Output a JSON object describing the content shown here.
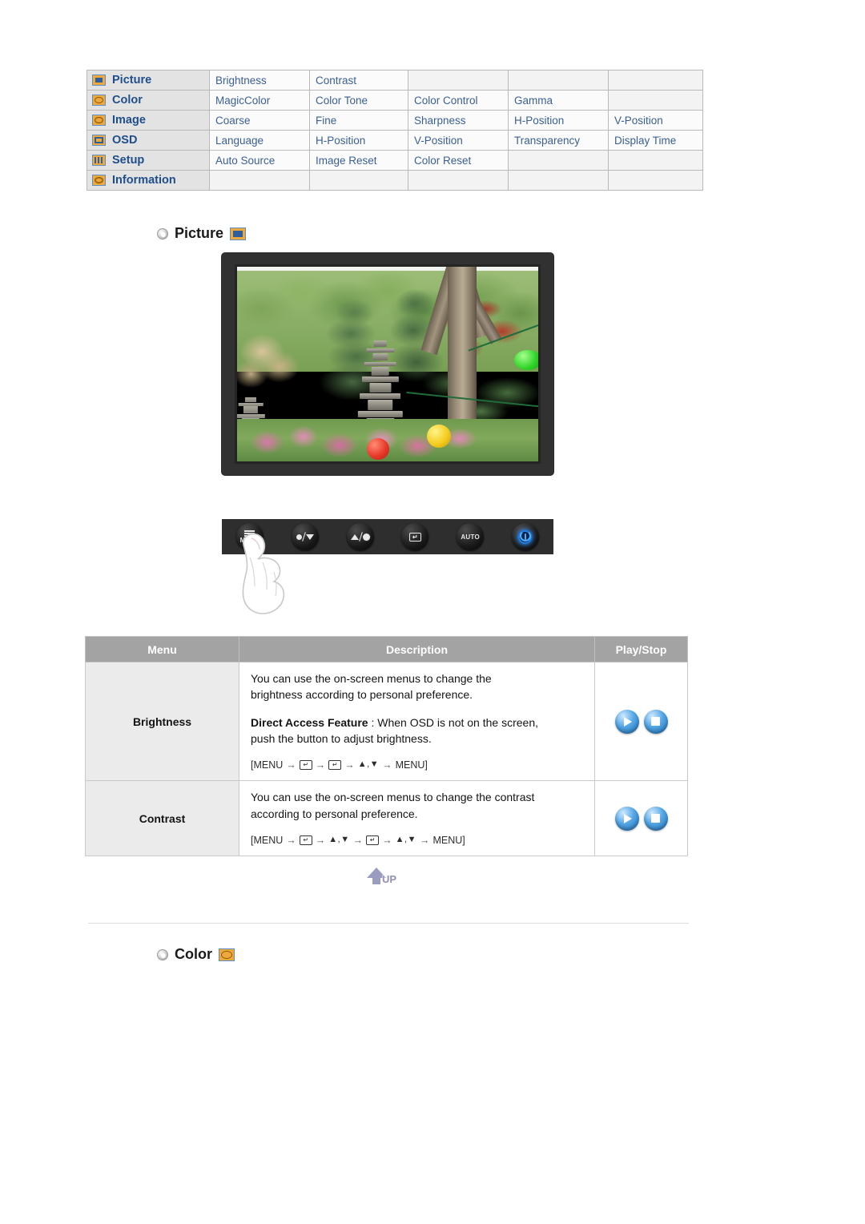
{
  "menu_map": {
    "rows": [
      {
        "icon": "picture-icon",
        "category": "Picture",
        "items": [
          "Brightness",
          "Contrast",
          "",
          "",
          ""
        ]
      },
      {
        "icon": "color-icon",
        "category": "Color",
        "items": [
          "MagicColor",
          "Color Tone",
          "Color Control",
          "Gamma",
          ""
        ]
      },
      {
        "icon": "image-icon",
        "category": "Image",
        "items": [
          "Coarse",
          "Fine",
          "Sharpness",
          "H-Position",
          "V-Position"
        ]
      },
      {
        "icon": "osd-icon",
        "category": "OSD",
        "items": [
          "Language",
          "H-Position",
          "V-Position",
          "Transparency",
          "Display Time"
        ]
      },
      {
        "icon": "setup-icon",
        "category": "Setup",
        "items": [
          "Auto Source",
          "Image Reset",
          "Color Reset",
          "",
          ""
        ]
      },
      {
        "icon": "information-icon",
        "category": "Information",
        "items": [
          "",
          "",
          "",
          "",
          ""
        ]
      }
    ]
  },
  "sections": {
    "picture": {
      "title": "Picture",
      "icon": "picture-icon"
    },
    "color": {
      "title": "Color",
      "icon": "color-icon"
    }
  },
  "monitor": {
    "alt": "Korean garden with stone pagodas, trees and paper lanterns shown on monitor screen"
  },
  "button_bar": {
    "buttons": [
      {
        "name": "menu-button",
        "label": "MENU"
      },
      {
        "name": "down-button",
        "label": ""
      },
      {
        "name": "brightness-up-button",
        "label": ""
      },
      {
        "name": "enter-button",
        "label": ""
      },
      {
        "name": "auto-button",
        "label": "AUTO"
      },
      {
        "name": "power-button",
        "label": ""
      }
    ]
  },
  "desc_table": {
    "headers": [
      "Menu",
      "Description",
      "Play/Stop"
    ],
    "rows": [
      {
        "menu": "Brightness",
        "line1": "You can use the on-screen menus to change the",
        "line2": "brightness according to personal preference.",
        "direct_label": "Direct Access Feature",
        "direct_text": " : When OSD is not on the screen,",
        "direct_text2": "push the button to adjust brightness.",
        "sequence": [
          "[MENU",
          "↵",
          "↵",
          "▲,▼",
          "MENU]"
        ]
      },
      {
        "menu": "Contrast",
        "line1": "You can use the on-screen menus to change the contrast",
        "line2": "according to personal preference.",
        "direct_label": "",
        "direct_text": "",
        "direct_text2": "",
        "sequence": [
          "[MENU",
          "↵",
          "▲,▼",
          "↵",
          "▲,▼",
          "MENU]"
        ]
      }
    ]
  },
  "up_button": {
    "label": "UP"
  },
  "colors": {
    "menu_text": "#3a5f96",
    "category_text": "#1f4e8c",
    "table_header_bg": "#a3a3a3",
    "icon_orange": "#eea93c",
    "icon_blue": "#5c8fc9",
    "accent_blue": "#1e6fb8"
  }
}
